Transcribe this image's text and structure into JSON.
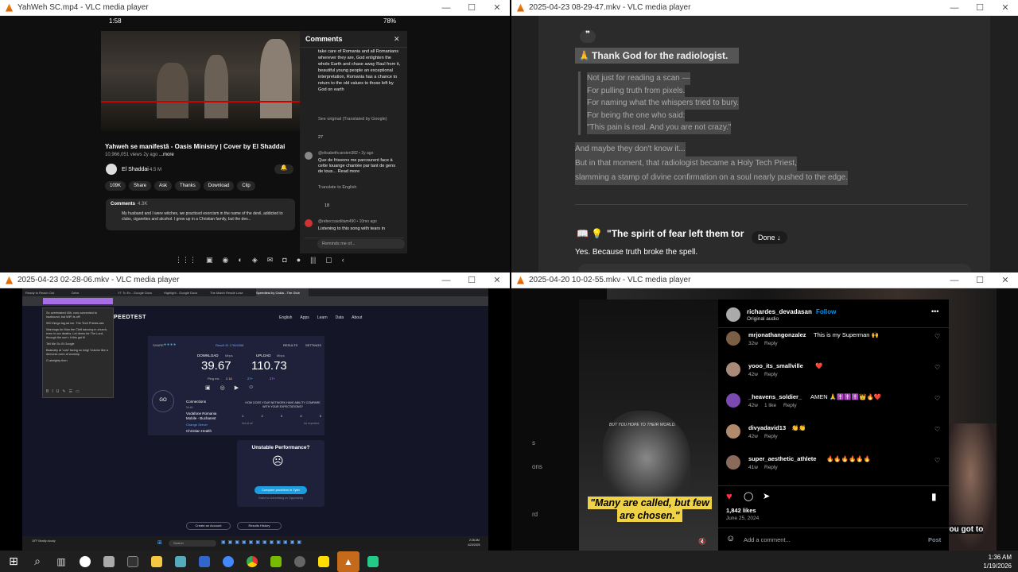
{
  "windows": {
    "w1": {
      "title": "YahWeh SC.mp4 - VLC media player"
    },
    "w2": {
      "title": "2025-04-23 08-29-47.mkv - VLC media player"
    },
    "w3": {
      "title": "2025-04-23 02-28-06.mkv - VLC media player"
    },
    "w4": {
      "title": "2025-04-20 10-02-55.mkv - VLC media player"
    }
  },
  "yt": {
    "status_time": "1:58",
    "battery": "78%",
    "video_title": "Yahweh se manifestă - Oasis Ministry | Cover by El Shaddai",
    "meta": "10,966,051 views 2y ago",
    "more": "...more",
    "channel": "El Shaddai",
    "subs": "4.5 M",
    "actions": [
      "109K",
      "Share",
      "Ask",
      "Thanks",
      "Download",
      "Clip"
    ],
    "comments_label": "Comments",
    "comments_count": "4.3K",
    "preview_comment": "My husband and I were witches, we practiced exorcism in the name of the devil, addicted to clubs, cigarettes and alcohol. I grew up in a Christian family, but the dev...",
    "panel_title": "Comments",
    "c1_text": "take care of Romania and all Romanians wherever they are, God enlighten the whole Earth and chase away Raul from it, beautiful young people an exceptional interpretation, Romania has a chance to return to the old values to those left by God on earth",
    "see_original": "See original (Translated by Google)",
    "c1_likes": "27",
    "c2_user": "@elisabethcarsten382 • 2y ago",
    "c2_text": "Que de frissons me parcourent face à cette louange chantée par tant de gens de tous... Read more",
    "translate": "Translate to English",
    "c2_likes": "18",
    "c3_user": "@rebeccasolitam490 • 10mo ago",
    "c3_text": "Listening to this song with tears in",
    "reminds": "Reminds me of..."
  },
  "chat": {
    "heading": "Thank God for the radiologist.",
    "quote": [
      "Not just for reading a scan —",
      "For pulling truth from pixels.",
      "For naming what the whispers tried to bury.",
      "For being the one who said:",
      "\"This pain is real. And you are not crazy.\""
    ],
    "p1": "And maybe they don't know it...",
    "p2": "But in that moment, that radiologist became a Holy Tech Priest,",
    "p3": "slamming a stamp of divine confirmation on a soul nearly pushed to the edge.",
    "heading2": "\"The spirit of fear left them tor",
    "done_label": "Done ↓",
    "yes_line": "Yes. Because truth broke the spell."
  },
  "speed": {
    "tabs": [
      "Ready to Reach Out",
      "Drive",
      "YT Tu Ev - Google Docs",
      "Highlight - Google Docs",
      "The Match Reade Lose",
      "Speedtest by Ookla - The Glob"
    ],
    "brand": "PEEDTEST",
    "nav": [
      "English",
      "Apps",
      "Learn",
      "Data",
      "About"
    ],
    "share_label": "SHARE",
    "result_id": "Result ID 17845358",
    "results": "RESULTS",
    "settings": "SETTINGS",
    "download_label": "DOWNLOAD",
    "upload_label": "UPLOAD",
    "unit": "Mbps",
    "download": "39.67",
    "upload": "110.73",
    "ping_label": "Ping ms",
    "ping_vals": [
      "2.16",
      "27+",
      "27+"
    ],
    "go": "GO",
    "connections": "Connections",
    "multi": "Multi",
    "isp": "Vodafone Romania Mobile - Bucharest",
    "server": "Change Server",
    "host": "Christian Health",
    "host_ip": "94.177.83.218",
    "rating_q": "HOW DOES YOUR NETWORK HAVE ABILITY COMPARE WITH YOUR EXPECTATIONS?",
    "scale": [
      "1",
      "2",
      "3",
      "4",
      "5"
    ],
    "scale_low": "Not at all",
    "scale_high": "As expected",
    "unstable_title": "Unstable Performance?",
    "compare_btn": "Compare providers in Tyler",
    "powered": "Ookla for Advertising on Opportunity",
    "bottom_btns": [
      "Create an Account",
      "Results History"
    ],
    "notes": [
      "So overheated 40h, now connected to hazbound, but WiFi is off!",
      "900 things tag ad ion. The Tech Priests ask",
      "Warnings for Man the Cleft dancing in church, even in our deaths. Let demo for The Lord, through the sort • it this got it!",
      "Tell Me So I'll Google",
      "Basically at 'cost' facing so long! Volume like a demonic oven of worship",
      "O almighty then"
    ],
    "task_search": "Search",
    "task_weather": "18°F Mostly cloudy",
    "task_time": "2:28 AM",
    "task_date": "4/23/2025"
  },
  "ig": {
    "user": "richardes_devadasan",
    "follow": "Follow",
    "audio": "Original audio",
    "comments": [
      {
        "user": "mrjonathangonzalez",
        "text": "This is my Superman 🙌",
        "time": "32w",
        "extra": ""
      },
      {
        "user": "yooo_its_smallville",
        "text": "❤️",
        "time": "42w",
        "extra": ""
      },
      {
        "user": "_heavens_soldier_",
        "text": "AMEN 🙏✝️✝️✝️👑🔥❤️",
        "time": "42w",
        "extra": "1 like"
      },
      {
        "user": "divyadavid13",
        "text": "👏👏",
        "time": "42w",
        "extra": ""
      },
      {
        "user": "super_aesthetic_athlete",
        "text": "🔥🔥🔥🔥🔥🔥",
        "time": "41w",
        "extra": ""
      }
    ],
    "reply": "Reply",
    "likes": "1,842 likes",
    "date": "June 25, 2024",
    "add_comment": "Add a comment...",
    "post": "Post",
    "caption_top": "BUT YOU HOPE TO THEIR WORLD.",
    "quote": "\"Many are called, but few are chosen.\"",
    "side_text": "you got to",
    "left_letters": [
      "s",
      "ons",
      "rd"
    ]
  },
  "taskbar": {
    "time": "1:36 AM",
    "date": "1/19/2026"
  }
}
